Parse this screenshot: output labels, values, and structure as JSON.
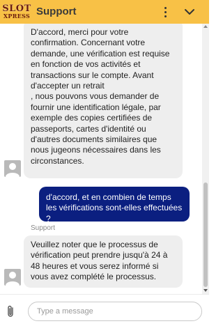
{
  "header": {
    "logo_top": "SLOT",
    "logo_bottom": "XPRESS",
    "title": "Support"
  },
  "messages": [
    {
      "role": "agent",
      "text": "D'accord, merci pour votre confirmation. Concernant votre demande, une vérification est requise en fonction de vos activités et transactions sur le compte. Avant d'accepter un retrait\n, nous pouvons vous demander de fournir une identification légale, par exemple des copies certifiées de passeports, cartes d'identité ou d'autres documents similaires que nous jugeons nécessaires dans les circonstances."
    },
    {
      "role": "user",
      "text": "d'accord, et en combien de temps les vérifications sont-elles effectuées ?"
    },
    {
      "role": "agent",
      "sender": "Support",
      "text": "Veuillez noter que le processus de vérification peut prendre jusqu'à 24 à 48 heures et vous serez informé si vous avez complété le processus."
    }
  ],
  "composer": {
    "placeholder": "Type a message"
  },
  "colors": {
    "header_bg": "#f8c146",
    "user_bubble": "#0b1f80",
    "agent_bubble": "#eeeeee"
  },
  "icons": {
    "menu": "more-vertical-icon",
    "collapse": "chevron-down-icon",
    "attach": "paperclip-icon",
    "avatar": "person-icon"
  }
}
